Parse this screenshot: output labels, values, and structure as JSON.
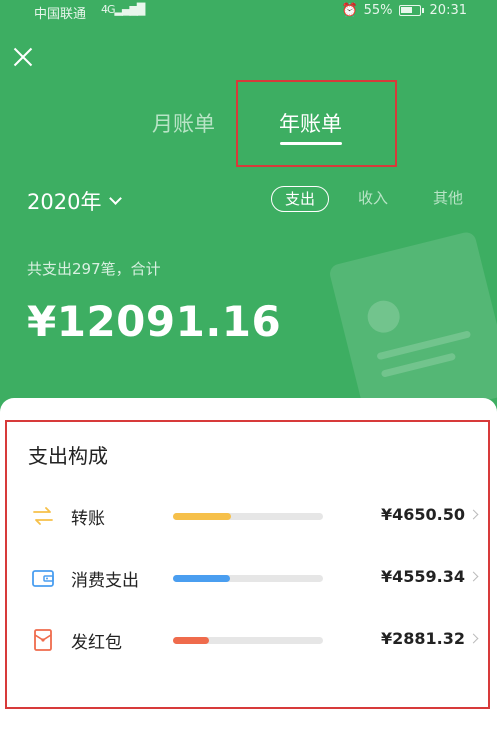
{
  "status_bar": {
    "carrier": "中国联通",
    "network": "4G",
    "alarm_icon": "alarm-clock-icon",
    "battery_percent": "55%",
    "time": "20:31"
  },
  "header": {
    "tabs": [
      {
        "label": "月账单",
        "active": false
      },
      {
        "label": "年账单",
        "active": true
      }
    ]
  },
  "filters": {
    "year": "2020年",
    "types": [
      {
        "label": "支出",
        "active": true
      },
      {
        "label": "收入",
        "active": false
      },
      {
        "label": "其他",
        "active": false
      }
    ]
  },
  "summary": {
    "text": "共支出297笔，合计",
    "total": "¥12091.16"
  },
  "breakdown": {
    "title": "支出构成",
    "items": [
      {
        "label": "转账",
        "amount": "¥4650.50",
        "ratio": 0.385,
        "color": "#f6c04a",
        "icon": "transfer-arrows-icon"
      },
      {
        "label": "消费支出",
        "amount": "¥4559.34",
        "ratio": 0.377,
        "color": "#4a9ef0",
        "icon": "wallet-icon"
      },
      {
        "label": "发红包",
        "amount": "¥2881.32",
        "ratio": 0.238,
        "color": "#ef6b4c",
        "icon": "red-envelope-icon"
      }
    ]
  },
  "colors": {
    "brand_green": "#3dae62",
    "annotation_red": "#d73a3a"
  }
}
